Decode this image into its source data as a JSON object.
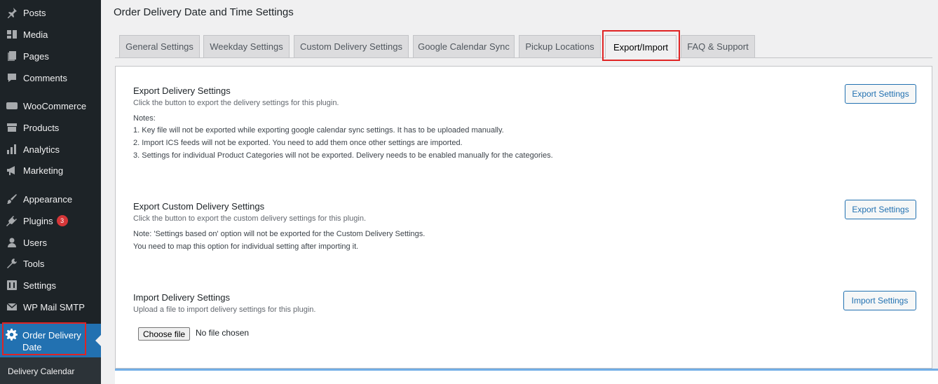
{
  "sidebar": {
    "items": [
      {
        "label": "Posts",
        "icon": "pin-icon"
      },
      {
        "label": "Media",
        "icon": "media-icon"
      },
      {
        "label": "Pages",
        "icon": "pages-icon"
      },
      {
        "label": "Comments",
        "icon": "comments-icon"
      },
      {
        "label": "WooCommerce",
        "icon": "woocommerce-icon"
      },
      {
        "label": "Products",
        "icon": "products-icon"
      },
      {
        "label": "Analytics",
        "icon": "analytics-icon"
      },
      {
        "label": "Marketing",
        "icon": "megaphone-icon"
      },
      {
        "label": "Appearance",
        "icon": "brush-icon"
      },
      {
        "label": "Plugins",
        "icon": "plugin-icon",
        "badge": "3"
      },
      {
        "label": "Users",
        "icon": "user-icon"
      },
      {
        "label": "Tools",
        "icon": "wrench-icon"
      },
      {
        "label": "Settings",
        "icon": "settings-icon"
      },
      {
        "label": "WP Mail SMTP",
        "icon": "mail-icon"
      }
    ],
    "active_item": {
      "label": "Order Delivery Date",
      "icon": "gear-icon"
    },
    "submenu": {
      "label": "Delivery Calendar"
    }
  },
  "page": {
    "title": "Order Delivery Date and Time Settings"
  },
  "tabs": [
    {
      "label": "General Settings"
    },
    {
      "label": "Weekday Settings"
    },
    {
      "label": "Custom Delivery Settings"
    },
    {
      "label": "Google Calendar Sync"
    },
    {
      "label": "Pickup Locations"
    },
    {
      "label": "Export/Import",
      "active": true
    },
    {
      "label": "FAQ & Support"
    }
  ],
  "export_section": {
    "title": "Export Delivery Settings",
    "description": "Click the button to export the delivery settings for this plugin.",
    "notes_label": "Notes:",
    "notes": [
      "1. Key file will not be exported while exporting google calendar sync settings. It has to be uploaded manually.",
      "2. Import ICS feeds will not be exported. You need to add them once other settings are imported.",
      "3. Settings for individual Product Categories will not be exported. Delivery needs to be enabled manually for the categories."
    ],
    "button_label": "Export Settings"
  },
  "custom_export_section": {
    "title": "Export Custom Delivery Settings",
    "description": "Click the button to export the custom delivery settings for this plugin.",
    "notes": [
      "Note: 'Settings based on' option will not be exported for the Custom Delivery Settings.",
      "You need to map this option for individual setting after importing it."
    ],
    "button_label": "Export Settings"
  },
  "import_section": {
    "title": "Import Delivery Settings",
    "description": "Upload a file to import delivery settings for this plugin.",
    "file_button_label": "Choose file",
    "file_status": "No file chosen",
    "button_label": "Import Settings"
  },
  "colors": {
    "sidebar_bg": "#1d2327",
    "active_menu_bg": "#2271b1",
    "accent": "#2271b1",
    "highlight_box": "#e02424",
    "badge": "#d63638"
  }
}
